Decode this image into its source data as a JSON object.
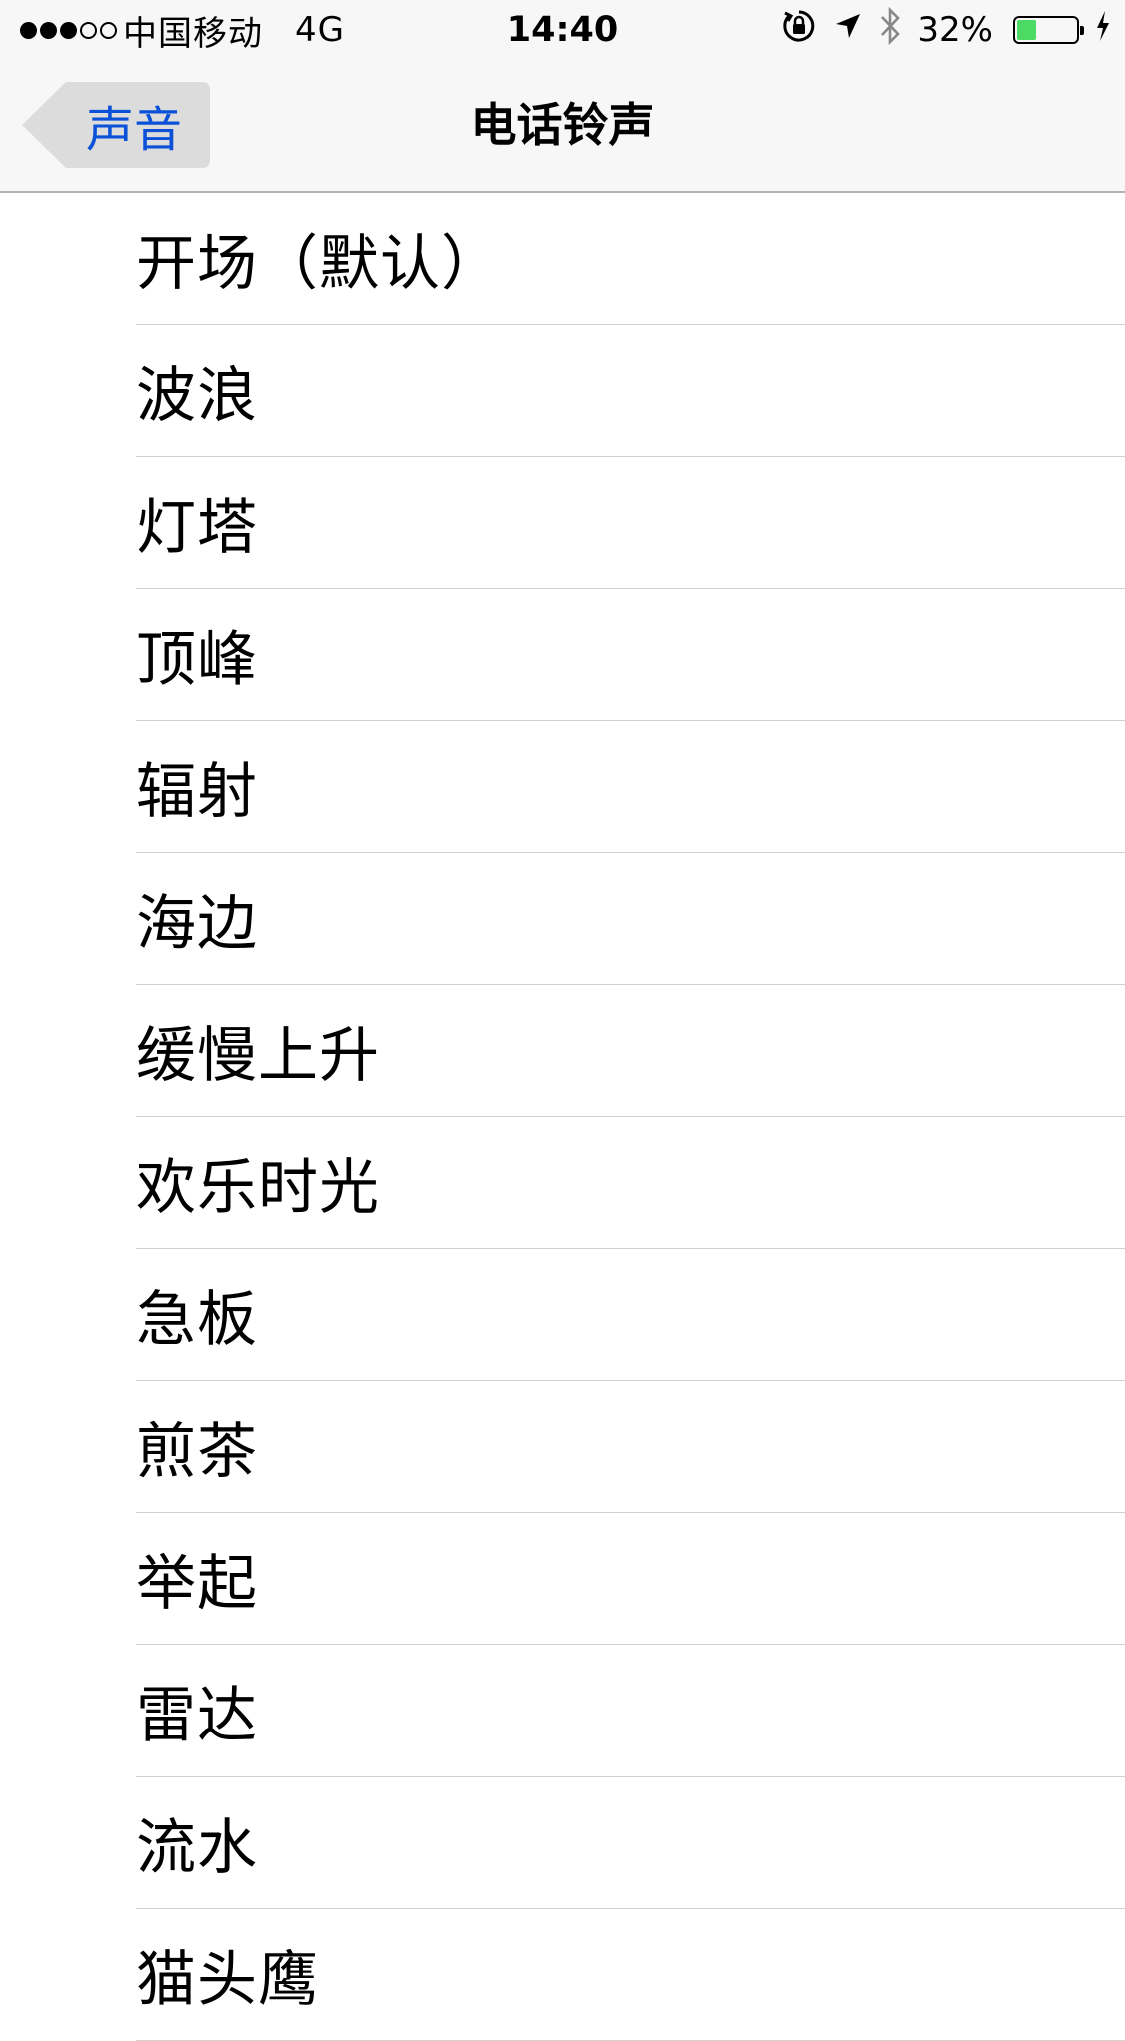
{
  "status_bar": {
    "signal_filled": 3,
    "signal_total": 5,
    "carrier": "中国移动",
    "network": "4G",
    "time": "14:40",
    "battery_text": "32%",
    "battery_level": 0.32,
    "icons": [
      "orientation-lock-icon",
      "location-arrow-icon",
      "bluetooth-icon",
      "battery-icon",
      "charging-bolt-icon"
    ]
  },
  "nav": {
    "back_label": "声音",
    "title": "电话铃声"
  },
  "ringtones": [
    {
      "label": "开场（默认）"
    },
    {
      "label": "波浪"
    },
    {
      "label": "灯塔"
    },
    {
      "label": "顶峰"
    },
    {
      "label": "辐射"
    },
    {
      "label": "海边"
    },
    {
      "label": "缓慢上升"
    },
    {
      "label": "欢乐时光"
    },
    {
      "label": "急板"
    },
    {
      "label": "煎茶"
    },
    {
      "label": "举起"
    },
    {
      "label": "雷达"
    },
    {
      "label": "流水"
    },
    {
      "label": "猫头鹰"
    }
  ],
  "colors": {
    "accent": "#0a51d8",
    "battery_fill": "#4cd964",
    "bar_background": "#f7f7f7",
    "separator": "#d0d0d0"
  }
}
